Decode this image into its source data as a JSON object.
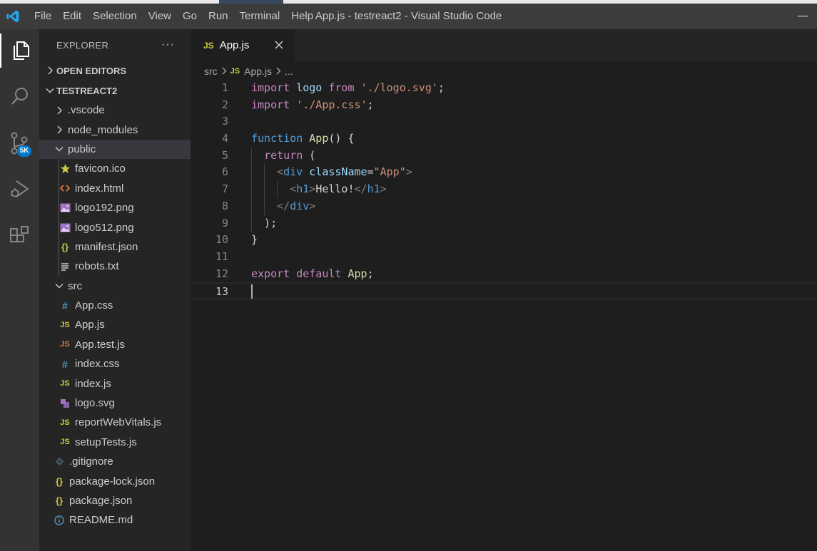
{
  "window": {
    "title": "App.js - testreact2 - Visual Studio Code",
    "menu": [
      "File",
      "Edit",
      "Selection",
      "View",
      "Go",
      "Run",
      "Terminal",
      "Help"
    ]
  },
  "activity_bar": {
    "items": [
      {
        "name": "explorer",
        "icon": "files-icon",
        "active": true
      },
      {
        "name": "search",
        "icon": "search-icon"
      },
      {
        "name": "source-control",
        "icon": "source-control-icon",
        "badge": "5K"
      },
      {
        "name": "run-debug",
        "icon": "run-debug-icon"
      },
      {
        "name": "extensions",
        "icon": "extensions-icon"
      }
    ]
  },
  "sidebar": {
    "title": "EXPLORER",
    "more": "···",
    "open_editors": "OPEN EDITORS",
    "project": "TESTREACT2",
    "tree": [
      {
        "label": ".vscode",
        "type": "folder",
        "expanded": false,
        "depth": 1
      },
      {
        "label": "node_modules",
        "type": "folder",
        "expanded": false,
        "depth": 1
      },
      {
        "label": "public",
        "type": "folder",
        "expanded": true,
        "depth": 1,
        "selected": true
      },
      {
        "label": "favicon.ico",
        "type": "file",
        "icon": "star-icon",
        "depth": 2
      },
      {
        "label": "index.html",
        "type": "file",
        "icon": "html-icon",
        "depth": 2
      },
      {
        "label": "logo192.png",
        "type": "file",
        "icon": "image-icon",
        "depth": 2
      },
      {
        "label": "logo512.png",
        "type": "file",
        "icon": "image-icon",
        "depth": 2
      },
      {
        "label": "manifest.json",
        "type": "file",
        "icon": "json-icon",
        "depth": 2
      },
      {
        "label": "robots.txt",
        "type": "file",
        "icon": "text-icon",
        "depth": 2
      },
      {
        "label": "src",
        "type": "folder",
        "expanded": true,
        "depth": 1
      },
      {
        "label": "App.css",
        "type": "file",
        "icon": "css-icon",
        "depth": 2
      },
      {
        "label": "App.js",
        "type": "file",
        "icon": "js-icon",
        "depth": 2
      },
      {
        "label": "App.test.js",
        "type": "file",
        "icon": "js-test-icon",
        "depth": 2
      },
      {
        "label": "index.css",
        "type": "file",
        "icon": "css-icon",
        "depth": 2
      },
      {
        "label": "index.js",
        "type": "file",
        "icon": "js-icon",
        "depth": 2
      },
      {
        "label": "logo.svg",
        "type": "file",
        "icon": "svg-icon",
        "depth": 2
      },
      {
        "label": "reportWebVitals.js",
        "type": "file",
        "icon": "js-icon",
        "depth": 2
      },
      {
        "label": "setupTests.js",
        "type": "file",
        "icon": "js-icon",
        "depth": 2
      },
      {
        "label": ".gitignore",
        "type": "file",
        "icon": "git-icon",
        "depth": 1
      },
      {
        "label": "package-lock.json",
        "type": "file",
        "icon": "json-icon",
        "depth": 1
      },
      {
        "label": "package.json",
        "type": "file",
        "icon": "json-icon",
        "depth": 1
      },
      {
        "label": "README.md",
        "type": "file",
        "icon": "info-icon",
        "depth": 1
      }
    ]
  },
  "editor": {
    "tab": {
      "icon_label": "JS",
      "name": "App.js"
    },
    "breadcrumb": {
      "folder": "src",
      "file_icon": "JS",
      "file": "App.js",
      "ellipsis": "..."
    },
    "current_line": 13,
    "lines": [
      {
        "n": "1"
      },
      {
        "n": "2"
      },
      {
        "n": "3"
      },
      {
        "n": "4"
      },
      {
        "n": "5"
      },
      {
        "n": "6"
      },
      {
        "n": "7"
      },
      {
        "n": "8"
      },
      {
        "n": "9"
      },
      {
        "n": "10"
      },
      {
        "n": "11"
      },
      {
        "n": "12"
      },
      {
        "n": "13"
      }
    ],
    "tokens": [
      [
        [
          "kw",
          "import"
        ],
        [
          "pl",
          " "
        ],
        [
          "va",
          "logo"
        ],
        [
          "pl",
          " "
        ],
        [
          "kw",
          "from"
        ],
        [
          "pl",
          " "
        ],
        [
          "st",
          "'./logo.svg'"
        ],
        [
          "pl",
          ";"
        ]
      ],
      [
        [
          "kw",
          "import"
        ],
        [
          "pl",
          " "
        ],
        [
          "st",
          "'./App.css'"
        ],
        [
          "pl",
          ";"
        ]
      ],
      [],
      [
        [
          "bl",
          "function"
        ],
        [
          "pl",
          " "
        ],
        [
          "fn",
          "App"
        ],
        [
          "pl",
          "() {"
        ]
      ],
      [
        [
          "pl",
          "  "
        ],
        [
          "kw",
          "return"
        ],
        [
          "pl",
          " ("
        ]
      ],
      [
        [
          "pl",
          "    "
        ],
        [
          "tp",
          "<"
        ],
        [
          "tg",
          "div"
        ],
        [
          "pl",
          " "
        ],
        [
          "at",
          "className"
        ],
        [
          "pl",
          "="
        ],
        [
          "st",
          "\"App\""
        ],
        [
          "tp",
          ">"
        ]
      ],
      [
        [
          "pl",
          "      "
        ],
        [
          "tp",
          "<"
        ],
        [
          "tg",
          "h1"
        ],
        [
          "tp",
          ">"
        ],
        [
          "pl",
          "Hello!"
        ],
        [
          "tp",
          "</"
        ],
        [
          "tg",
          "h1"
        ],
        [
          "tp",
          ">"
        ]
      ],
      [
        [
          "pl",
          "    "
        ],
        [
          "tp",
          "</"
        ],
        [
          "tg",
          "div"
        ],
        [
          "tp",
          ">"
        ]
      ],
      [
        [
          "pl",
          "  );"
        ]
      ],
      [
        [
          "pl",
          "}"
        ]
      ],
      [],
      [
        [
          "kw",
          "export"
        ],
        [
          "pl",
          " "
        ],
        [
          "kw",
          "default"
        ],
        [
          "pl",
          " "
        ],
        [
          "fn",
          "App"
        ],
        [
          "pl",
          ";"
        ]
      ],
      []
    ]
  },
  "colors": {
    "accent": "#007acc",
    "js": "#cbcb41",
    "keyword": "#c586c0",
    "string": "#ce9178"
  }
}
